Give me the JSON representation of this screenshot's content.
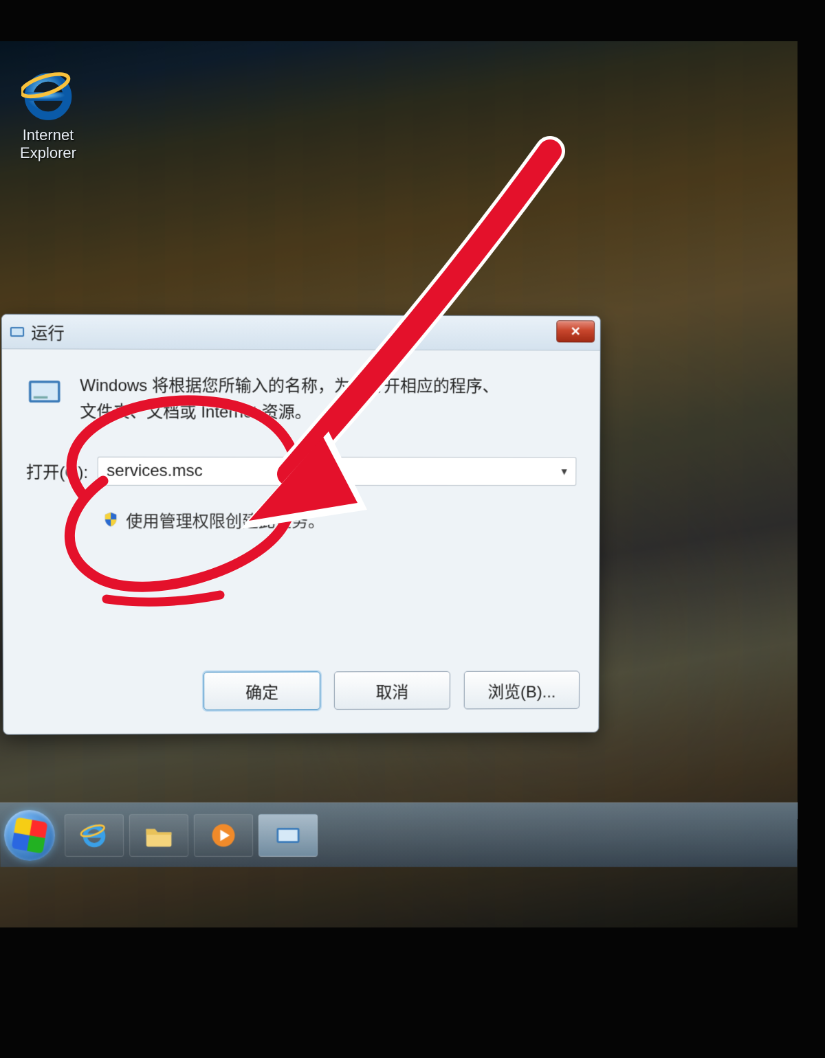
{
  "desktop": {
    "ie_label_line1": "Internet",
    "ie_label_line2": "Explorer"
  },
  "run_dialog": {
    "title": "运行",
    "description_line1": "Windows 将根据您所输入的名称，为您打开相应的程序、",
    "description_line2": "文件夹、文档或 Internet 资源。",
    "open_label": "打开(O):",
    "open_value": "services.msc",
    "admin_note": "使用管理权限创建此任务。",
    "ok_label": "确定",
    "cancel_label": "取消",
    "browse_label": "浏览(B)..."
  },
  "taskbar": {
    "items": [
      "start",
      "ie",
      "explorer",
      "wmp",
      "run"
    ]
  }
}
